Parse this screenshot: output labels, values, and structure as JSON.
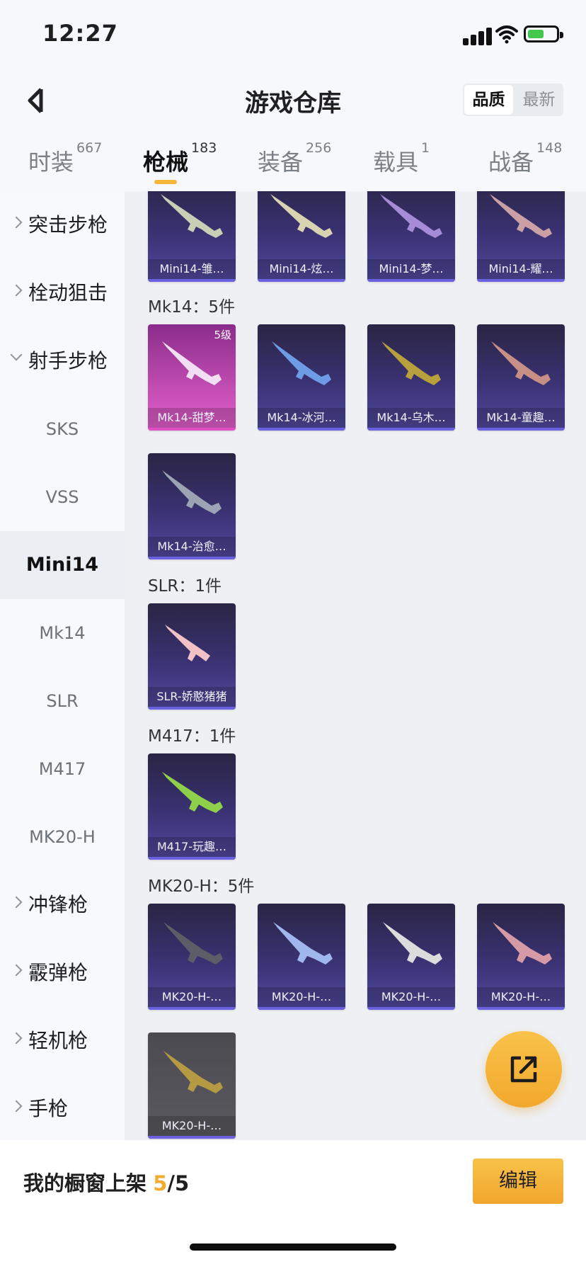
{
  "status_bar": {
    "time": "12:27"
  },
  "header": {
    "title": "游戏仓库",
    "sort_options": [
      "品质",
      "最新"
    ]
  },
  "tabs": [
    {
      "label": "时装",
      "count": "667"
    },
    {
      "label": "枪械",
      "count": "183"
    },
    {
      "label": "装备",
      "count": "256"
    },
    {
      "label": "载具",
      "count": "1"
    },
    {
      "label": "战备",
      "count": "148"
    }
  ],
  "sidebar": {
    "categories": [
      "突击步枪",
      "栓动狙击",
      "射手步枪",
      "冲锋枪",
      "霰弹枪",
      "轻机枪",
      "手枪"
    ],
    "subitems": [
      "SKS",
      "VSS",
      "Mini14",
      "Mk14",
      "SLR",
      "M417",
      "MK20-H"
    ]
  },
  "groups": [
    {
      "title": "Mk14：5件"
    },
    {
      "title": "SLR：1件"
    },
    {
      "title": "M417：1件"
    },
    {
      "title": "MK20-H：5件"
    }
  ],
  "items": [
    {
      "name": "Mini14-雏…"
    },
    {
      "name": "Mini14-炫…"
    },
    {
      "name": "Mini14-梦…"
    },
    {
      "name": "Mini14-耀…"
    },
    {
      "name": "Mk14-甜梦…",
      "level": "5级"
    },
    {
      "name": "Mk14-冰河…"
    },
    {
      "name": "Mk14-乌木…"
    },
    {
      "name": "Mk14-童趣…"
    },
    {
      "name": "Mk14-治愈…"
    },
    {
      "name": "SLR-娇憨猪猪"
    },
    {
      "name": "M417-玩趣…"
    },
    {
      "name": "MK20-H-…"
    },
    {
      "name": "MK20-H-…"
    },
    {
      "name": "MK20-H-…"
    },
    {
      "name": "MK20-H-…"
    },
    {
      "name": "MK20-H-…"
    }
  ],
  "bottom": {
    "shelf_label": "我的橱窗上架",
    "shelf_count": "5",
    "shelf_total": "/5",
    "edit_label": "编辑"
  },
  "icons": [
    "back-arrow-icon",
    "chevron-right-icon",
    "chevron-down-icon",
    "share-export-icon",
    "signal-icon",
    "wifi-icon",
    "battery-icon"
  ],
  "colors": {
    "accent": "#f4b73b",
    "card_bg": "#3a3273",
    "card_highlight": "#c24db3"
  }
}
